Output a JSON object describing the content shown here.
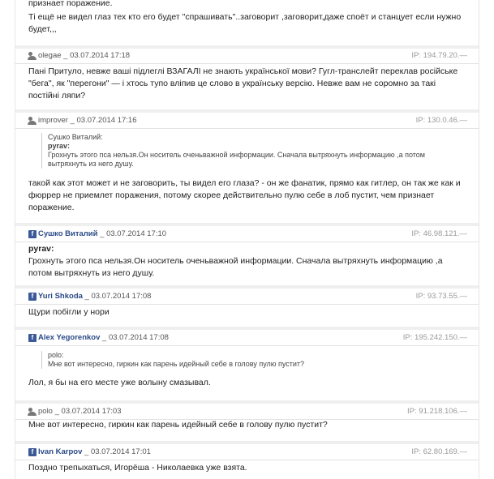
{
  "top_fragment": {
    "line1": "признает поражение.",
    "text": "Ті ещё не видел глаз тех кто его будет \"спрашивать\"..заговорит ,заговорит,даже споёт и станцует если нужно будет,,,"
  },
  "comments": [
    {
      "author": "olegae",
      "source": "site",
      "date": "03.07.2014 17:18",
      "ip": "IP: 194.79.20.—",
      "text": "Пані Притуло, невже ваші підлеглі ВЗАГАЛІ не знають української мови? Гугл-транслейт переклав російське \"бега\", як \"перегони\" — і хтось тупо вліпив це слово в українську версію. Невже вам не соромно за такі постійні ляпи?"
    },
    {
      "author": "improver",
      "source": "site",
      "date": "03.07.2014 17:16",
      "ip": "IP: 130.0.46.—",
      "quote_author": "Сушко Виталий:",
      "quote_inner_author": "pyrav:",
      "quote_text": "Грохнуть этого пса нельзя.Он носитель оченьважной информации. Сначала вытряхнуть информацию ,а потом вытряхнуть из него душу.",
      "text": "такой как этот может и не заговорить, ты видел его глаза? - он же фанатик, прямо как гитлер, он так же как и фюррер не приемлет поражения, потому скорее действительно пулю себе в лоб пустит, чем признает поражение."
    },
    {
      "author": "Сушко Виталий",
      "source": "facebook",
      "date": "03.07.2014 17:10",
      "ip": "IP: 46.98.121.—",
      "bold_line": "pyrav:",
      "text": "Грохнуть этого пса нельзя.Он носитель оченьважной информации. Сначала вытряхнуть информацию ,а потом вытряхнуть из него душу."
    },
    {
      "author": "Yuri Shkoda",
      "source": "facebook",
      "date": "03.07.2014 17:08",
      "ip": "IP: 93.73.55.—",
      "text": "Щури побігли у нори"
    },
    {
      "author": "Alex Yegorenkov",
      "source": "facebook",
      "date": "03.07.2014 17:08",
      "ip": "IP: 195.242.150.—",
      "quote_author": "polo:",
      "quote_text": "Мне вот интересно, гиркин как парень идейный себе в голову пулю пустит?",
      "text": "Лол, я бы на его месте уже волыну смазывал."
    },
    {
      "author": "polo",
      "source": "site",
      "date": "03.07.2014 17:03",
      "ip": "IP: 91.218.106.—",
      "text": "Мне вот интересно, гиркин как парень идейный себе в голову пулю пустит?"
    },
    {
      "author": "Ivan Karpov",
      "source": "facebook",
      "date": "03.07.2014 17:01",
      "ip": "IP: 62.80.169.—",
      "text": "Поздно трепыхаться, Игорёша - Николаевка уже взята."
    }
  ],
  "icons": {
    "site_user": "user-icon",
    "facebook": "facebook-icon"
  },
  "colors": {
    "facebook_blue": "#3b5998",
    "author_fb": "#2a4a86",
    "ip_gray": "#9a9a9a"
  }
}
